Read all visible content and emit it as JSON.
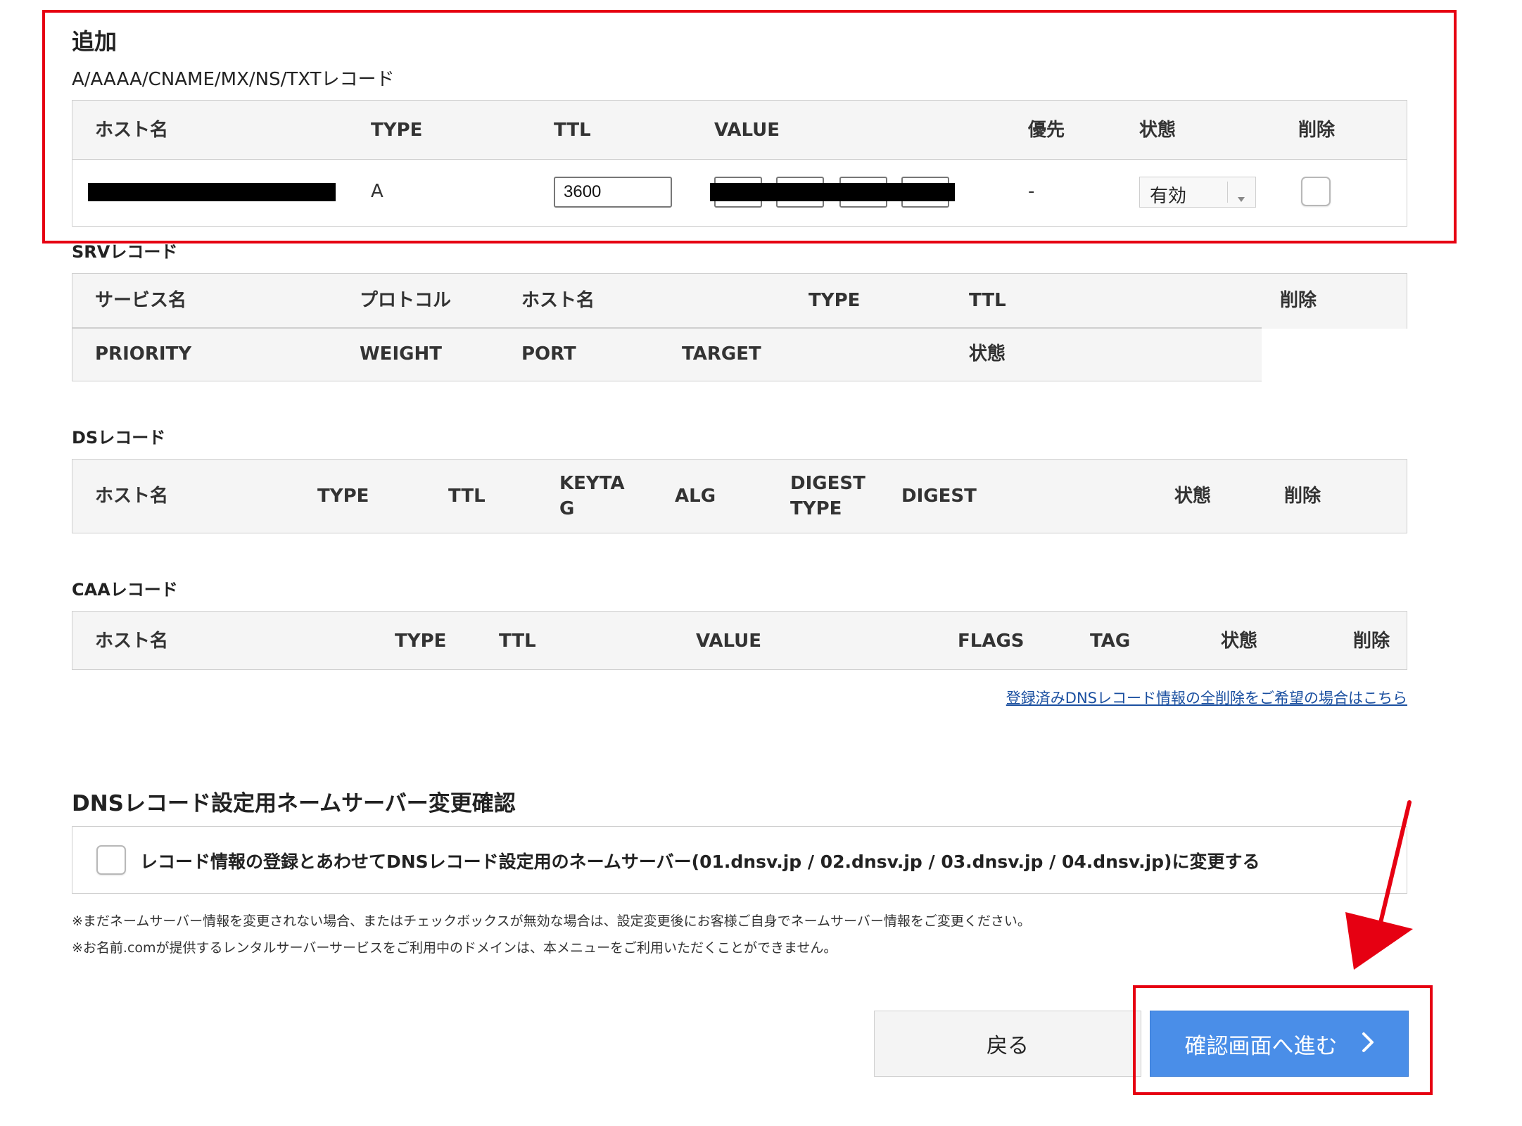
{
  "add_section": {
    "title": "追加",
    "subtitle": "A/AAAA/CNAME/MX/NS/TXTレコード",
    "headers": [
      "ホスト名",
      "TYPE",
      "TTL",
      "VALUE",
      "優先",
      "状態",
      "削除"
    ],
    "row": {
      "type": "A",
      "ttl": "3600",
      "priority": "-",
      "status": "有効"
    }
  },
  "srv_section": {
    "title": "SRVレコード",
    "headers_row1": [
      "サービス名",
      "プロトコル",
      "ホスト名",
      "TYPE",
      "TTL",
      "削除"
    ],
    "headers_row2": [
      "PRIORITY",
      "WEIGHT",
      "PORT",
      "TARGET",
      "状態"
    ]
  },
  "ds_section": {
    "title": "DSレコード",
    "headers": [
      "ホスト名",
      "TYPE",
      "TTL",
      "KEYTA\nG",
      "ALG",
      "DIGEST\nTYPE",
      "DIGEST",
      "状態",
      "削除"
    ]
  },
  "caa_section": {
    "title": "CAAレコード",
    "headers": [
      "ホスト名",
      "TYPE",
      "TTL",
      "VALUE",
      "FLAGS",
      "TAG",
      "状態",
      "削除"
    ]
  },
  "delete_all_link": "登録済みDNSレコード情報の全削除をご希望の場合はこちら",
  "ns_section": {
    "title": "DNSレコード設定用ネームサーバー変更確認",
    "checkbox_label": "レコード情報の登録とあわせてDNSレコード設定用のネームサーバー(01.dnsv.jp / 02.dnsv.jp / 03.dnsv.jp / 04.dnsv.jp)に変更する",
    "note1": "※まだネームサーバー情報を変更されない場合、またはチェックボックスが無効な場合は、設定変更後にお客様ご自身でネームサーバー情報をご変更ください。",
    "note2": "※お名前.comが提供するレンタルサーバーサービスをご利用中のドメインは、本メニューをご利用いただくことができません。"
  },
  "buttons": {
    "back": "戻る",
    "next": "確認画面へ進む"
  },
  "colors": {
    "accent": "#4a8ee8",
    "highlight": "#e60012",
    "link": "#1a4fa0"
  }
}
